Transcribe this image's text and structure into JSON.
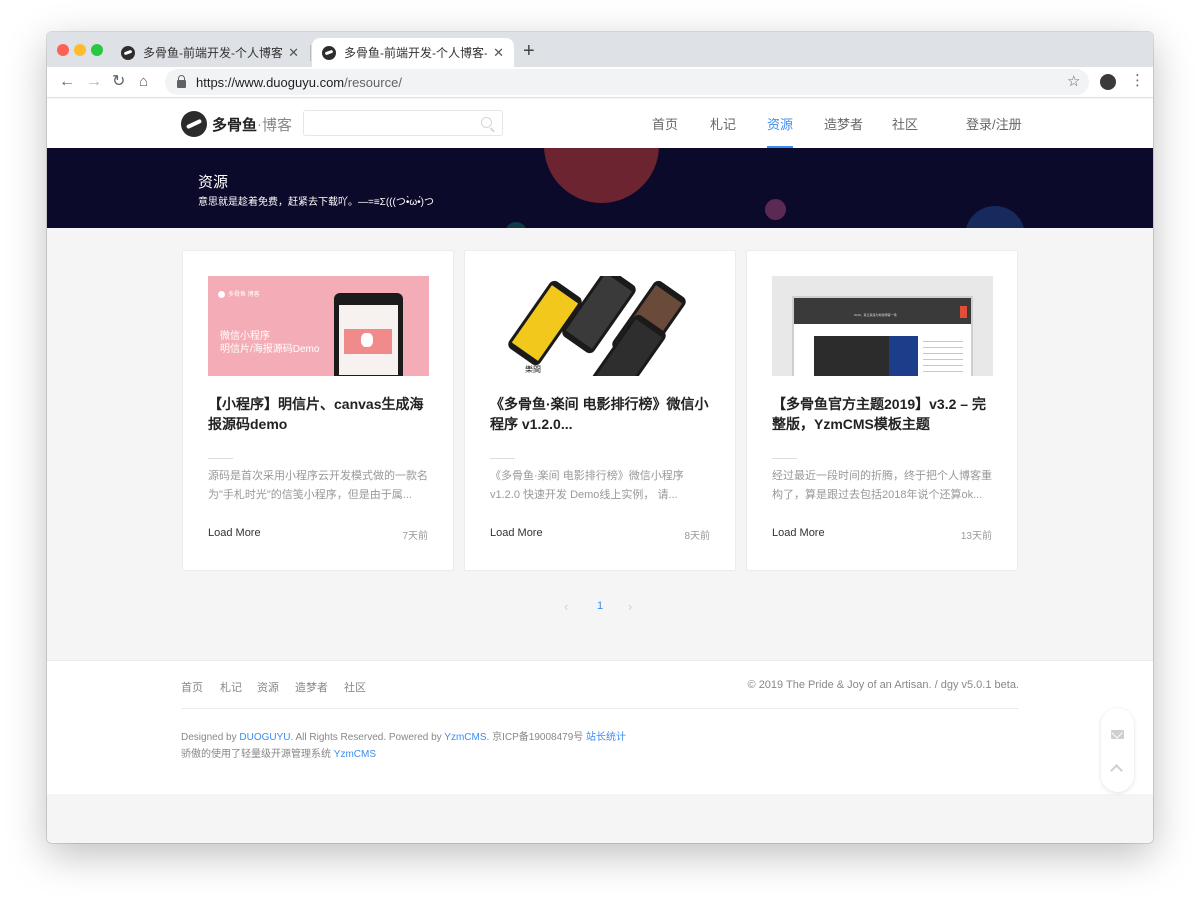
{
  "browser": {
    "tabs": [
      {
        "title": "多骨鱼-前端开发-个人博客-模版",
        "close": "✕"
      },
      {
        "title": "多骨鱼-前端开发-个人博客-模版",
        "close": "✕"
      }
    ],
    "new_tab": "+",
    "url_host": "https://www.duoguyu.com",
    "url_path": "/resource/"
  },
  "header": {
    "logo_name": "多骨鱼",
    "logo_dot": "·",
    "logo_sub": "博客",
    "search_placeholder": "",
    "nav": [
      "首页",
      "札记",
      "资源",
      "造梦者",
      "社区"
    ],
    "active_nav": "资源",
    "login": "登录/注册"
  },
  "banner": {
    "title": "资源",
    "subtitle": "意思就是趁着免费，赶紧去下载吖。—=≡Σ(((つ•̀ω•́)つ"
  },
  "cards": [
    {
      "thumb_line1": "微信小程序",
      "thumb_line2": "明信片/海报源码Demo",
      "thumb_brand": "多骨鱼 博客",
      "title": "【小程序】明信片、canvas生成海报源码demo",
      "excerpt": "源码是首次采用小程序云开发模式做的一款名为\"手札时光\"的信笺小程序，但是由于属...",
      "more": "Load More",
      "date": "7天前"
    },
    {
      "thumb_brand": "樂間",
      "title": "《多骨鱼·楽间 电影排行榜》微信小程序 v1.2.0...",
      "excerpt": "《多骨鱼·楽间 电影排行榜》微信小程序 v1.2.0 快速开发 Demo线上实例， 请...",
      "more": "Load More",
      "date": "8天前"
    },
    {
      "thumb_header": "2019，就让我来为你建博客一场",
      "title": "【多骨鱼官方主题2019】v3.2 – 完整版，YzmCMS模板主题",
      "excerpt": "经过最近一段时间的折腾，终于把个人博客重构了，算是跟过去包括2018年说个还算ok...",
      "more": "Load More",
      "date": "13天前"
    }
  ],
  "pagination": {
    "prev": "‹",
    "current": "1",
    "next": "›"
  },
  "footer": {
    "links": [
      "首页",
      "札记",
      "资源",
      "造梦者",
      "社区"
    ],
    "copyright": "© 2019 The Pride & Joy of an Artisan. / dgy v5.0.1 beta.",
    "designed_by": "Designed by",
    "designer": "DUOGUYU",
    "rights": ". All Rights Reserved. Powered by",
    "powered": "YzmCMS",
    "icp": ". 京ICP备19008479号",
    "stats": "站长统计",
    "line2_prefix": "骄傲的使用了轻量级开源管理系统",
    "line2_link": "YzmCMS"
  },
  "colors": {
    "accent": "#3d8cf2",
    "banner_bg": "#0c0a2a",
    "page_bg": "#f5f5f5"
  }
}
